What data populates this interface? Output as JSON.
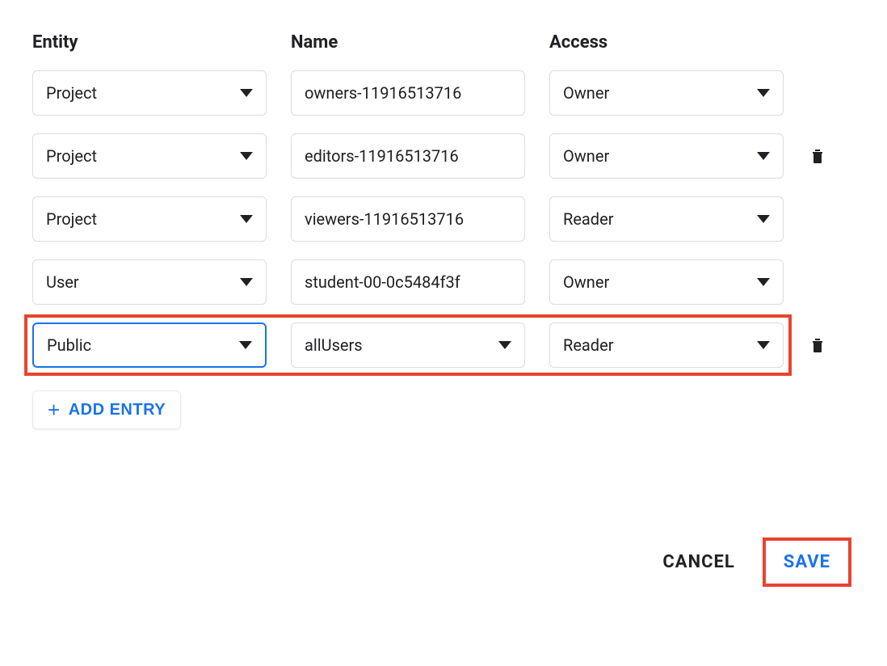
{
  "headers": {
    "entity": "Entity",
    "name": "Name",
    "access": "Access"
  },
  "rows": [
    {
      "entity": "Project",
      "name": "owners-11916513716",
      "access": "Owner",
      "name_is_dropdown": false,
      "deletable": false,
      "focused": false
    },
    {
      "entity": "Project",
      "name": "editors-11916513716",
      "access": "Owner",
      "name_is_dropdown": false,
      "deletable": true,
      "focused": false
    },
    {
      "entity": "Project",
      "name": "viewers-11916513716",
      "access": "Reader",
      "name_is_dropdown": false,
      "deletable": false,
      "focused": false
    },
    {
      "entity": "User",
      "name": "student-00-0c5484f3f",
      "access": "Owner",
      "name_is_dropdown": false,
      "deletable": false,
      "focused": false
    },
    {
      "entity": "Public",
      "name": "allUsers",
      "access": "Reader",
      "name_is_dropdown": true,
      "deletable": true,
      "focused": true
    }
  ],
  "add_entry_label": "ADD ENTRY",
  "buttons": {
    "cancel": "CANCEL",
    "save": "SAVE"
  }
}
